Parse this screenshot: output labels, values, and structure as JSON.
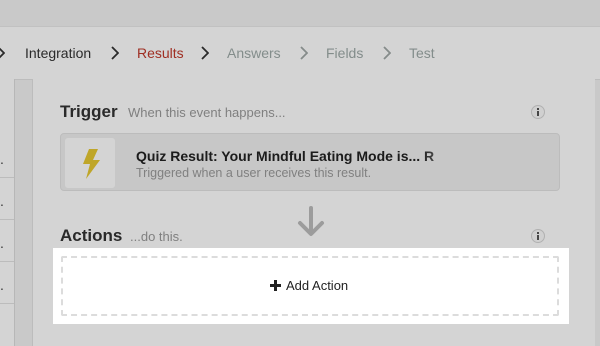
{
  "breadcrumb": {
    "items": [
      {
        "label": "Integration",
        "state": "done"
      },
      {
        "label": "Results",
        "state": "current"
      },
      {
        "label": "Answers",
        "state": "todo"
      },
      {
        "label": "Fields",
        "state": "todo"
      },
      {
        "label": "Test",
        "state": "todo"
      }
    ]
  },
  "sidebar": {
    "rows": [
      ".",
      ".",
      ".",
      "."
    ]
  },
  "trigger": {
    "title": "Trigger",
    "subtitle": "When this event happens...",
    "card": {
      "icon": "lightning-bolt-icon",
      "title": "Quiz Result: Your Mindful Eating Mode is... R",
      "description": "Triggered when a user receives this result."
    }
  },
  "actions": {
    "title": "Actions",
    "subtitle": "...do this.",
    "add_label": "Add Action"
  },
  "colors": {
    "accent_current": "#c0392b",
    "bolt": "#e6c832",
    "overlay": "rgba(0,0,0,0.17)"
  }
}
